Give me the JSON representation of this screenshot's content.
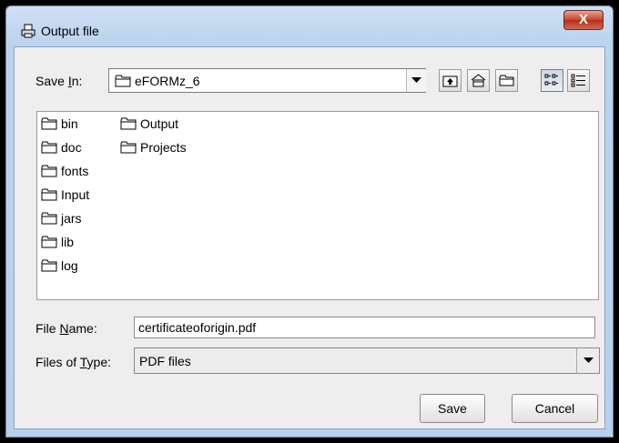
{
  "window": {
    "title": "Output file",
    "close_label": "X"
  },
  "save_in": {
    "label_prefix": "Save ",
    "label_mnemonic": "I",
    "label_suffix": "n:",
    "value": "eFORMz_6"
  },
  "toolbar": [
    "up-one-level",
    "home",
    "new-folder",
    "list-view",
    "details-view"
  ],
  "files": [
    {
      "name": "bin"
    },
    {
      "name": "doc"
    },
    {
      "name": "fonts"
    },
    {
      "name": "Input"
    },
    {
      "name": "jars"
    },
    {
      "name": "lib"
    },
    {
      "name": "log"
    },
    {
      "name": "Output"
    },
    {
      "name": "Projects"
    }
  ],
  "file_name": {
    "label_prefix": "File ",
    "label_mnemonic": "N",
    "label_suffix": "ame:",
    "value": "certificateoforigin.pdf"
  },
  "file_type": {
    "label_prefix": "Files of ",
    "label_mnemonic": "T",
    "label_suffix": "ype:",
    "value": "PDF files"
  },
  "buttons": {
    "save": "Save",
    "cancel": "Cancel"
  }
}
